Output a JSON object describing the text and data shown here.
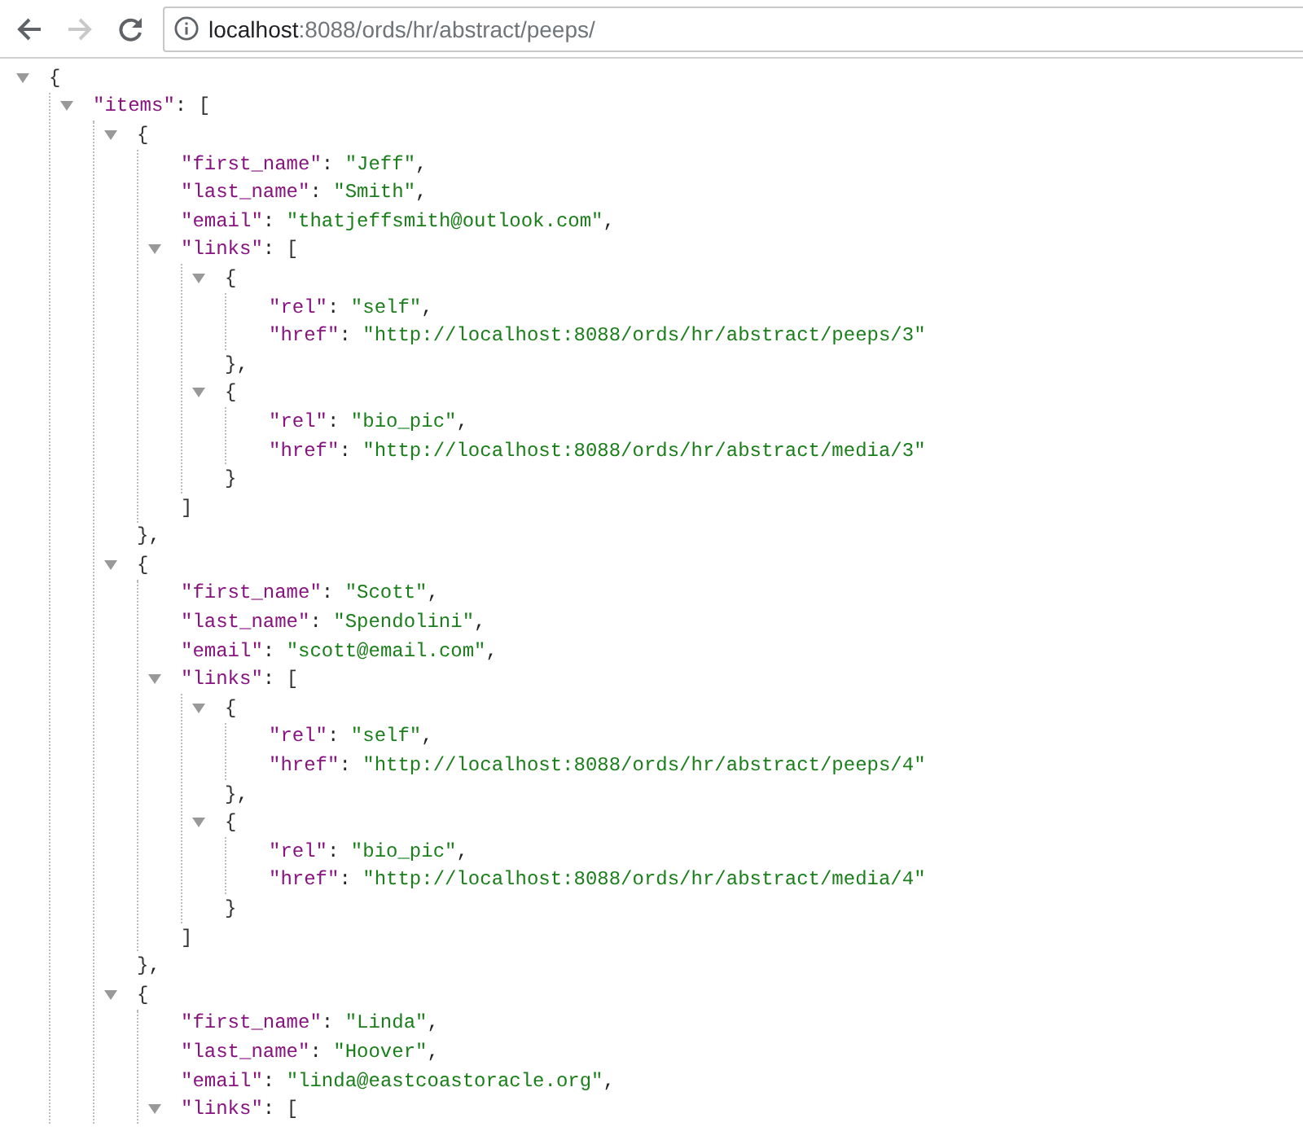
{
  "browser": {
    "url_host": "localhost",
    "url_path": ":8088/ords/hr/abstract/peeps/",
    "forward_disabled": true
  },
  "tree": {
    "kind": "container",
    "open": "{",
    "expanded": true,
    "children": [
      {
        "kind": "container",
        "key": "\"items\"",
        "colon": ":",
        "open": "[",
        "expanded": true,
        "children": [
          {
            "kind": "container",
            "open": "{",
            "expanded": true,
            "close": "}",
            "comma": ",",
            "children": [
              {
                "kind": "leaf",
                "key": "\"first_name\"",
                "colon": ":",
                "value": "\"Jeff\"",
                "comma": ","
              },
              {
                "kind": "leaf",
                "key": "\"last_name\"",
                "colon": ":",
                "value": "\"Smith\"",
                "comma": ","
              },
              {
                "kind": "leaf",
                "key": "\"email\"",
                "colon": ":",
                "value": "\"thatjeffsmith@outlook.com\"",
                "comma": ","
              },
              {
                "kind": "container",
                "key": "\"links\"",
                "colon": ":",
                "open": "[",
                "expanded": true,
                "close": "]",
                "children": [
                  {
                    "kind": "container",
                    "open": "{",
                    "expanded": true,
                    "close": "}",
                    "comma": ",",
                    "children": [
                      {
                        "kind": "leaf",
                        "key": "\"rel\"",
                        "colon": ":",
                        "value": "\"self\"",
                        "comma": ","
                      },
                      {
                        "kind": "leaf",
                        "key": "\"href\"",
                        "colon": ":",
                        "value": "\"http://localhost:8088/ords/hr/abstract/peeps/3\""
                      }
                    ]
                  },
                  {
                    "kind": "container",
                    "open": "{",
                    "expanded": true,
                    "close": "}",
                    "children": [
                      {
                        "kind": "leaf",
                        "key": "\"rel\"",
                        "colon": ":",
                        "value": "\"bio_pic\"",
                        "comma": ","
                      },
                      {
                        "kind": "leaf",
                        "key": "\"href\"",
                        "colon": ":",
                        "value": "\"http://localhost:8088/ords/hr/abstract/media/3\""
                      }
                    ]
                  }
                ]
              }
            ]
          },
          {
            "kind": "container",
            "open": "{",
            "expanded": true,
            "close": "}",
            "comma": ",",
            "children": [
              {
                "kind": "leaf",
                "key": "\"first_name\"",
                "colon": ":",
                "value": "\"Scott\"",
                "comma": ","
              },
              {
                "kind": "leaf",
                "key": "\"last_name\"",
                "colon": ":",
                "value": "\"Spendolini\"",
                "comma": ","
              },
              {
                "kind": "leaf",
                "key": "\"email\"",
                "colon": ":",
                "value": "\"scott@email.com\"",
                "comma": ","
              },
              {
                "kind": "container",
                "key": "\"links\"",
                "colon": ":",
                "open": "[",
                "expanded": true,
                "close": "]",
                "children": [
                  {
                    "kind": "container",
                    "open": "{",
                    "expanded": true,
                    "close": "}",
                    "comma": ",",
                    "children": [
                      {
                        "kind": "leaf",
                        "key": "\"rel\"",
                        "colon": ":",
                        "value": "\"self\"",
                        "comma": ","
                      },
                      {
                        "kind": "leaf",
                        "key": "\"href\"",
                        "colon": ":",
                        "value": "\"http://localhost:8088/ords/hr/abstract/peeps/4\""
                      }
                    ]
                  },
                  {
                    "kind": "container",
                    "open": "{",
                    "expanded": true,
                    "close": "}",
                    "children": [
                      {
                        "kind": "leaf",
                        "key": "\"rel\"",
                        "colon": ":",
                        "value": "\"bio_pic\"",
                        "comma": ","
                      },
                      {
                        "kind": "leaf",
                        "key": "\"href\"",
                        "colon": ":",
                        "value": "\"http://localhost:8088/ords/hr/abstract/media/4\""
                      }
                    ]
                  }
                ]
              }
            ]
          },
          {
            "kind": "container",
            "open": "{",
            "expanded": true,
            "children": [
              {
                "kind": "leaf",
                "key": "\"first_name\"",
                "colon": ":",
                "value": "\"Linda\"",
                "comma": ","
              },
              {
                "kind": "leaf",
                "key": "\"last_name\"",
                "colon": ":",
                "value": "\"Hoover\"",
                "comma": ","
              },
              {
                "kind": "leaf",
                "key": "\"email\"",
                "colon": ":",
                "value": "\"linda@eastcoastoracle.org\"",
                "comma": ","
              },
              {
                "kind": "container",
                "key": "\"links\"",
                "colon": ":",
                "open": "[",
                "expanded": true
              }
            ]
          }
        ]
      }
    ]
  }
}
